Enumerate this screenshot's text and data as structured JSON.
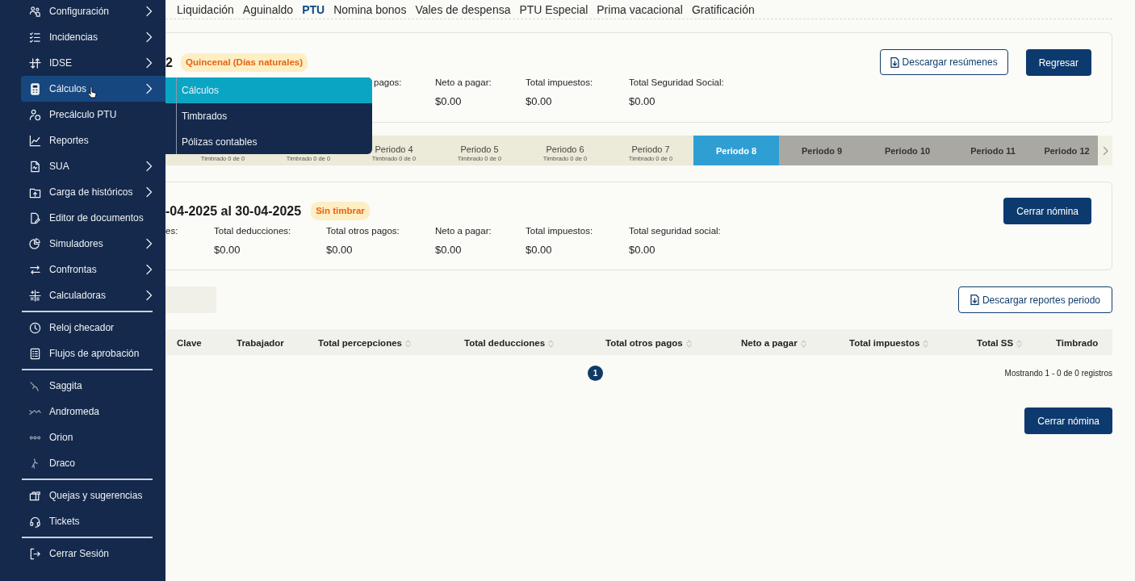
{
  "sidebar": {
    "groups": [
      {
        "items": [
          {
            "label": "Configuración",
            "submenu": true,
            "selected": false
          },
          {
            "label": "Incidencias",
            "submenu": true,
            "selected": false
          },
          {
            "label": "IDSE",
            "submenu": true,
            "selected": false
          },
          {
            "label": "Cálculos",
            "submenu": true,
            "selected": true
          },
          {
            "label": "Precálculo PTU",
            "submenu": false,
            "selected": false
          },
          {
            "label": "Reportes",
            "submenu": false,
            "selected": false
          },
          {
            "label": "SUA",
            "submenu": true,
            "selected": false
          },
          {
            "label": "Carga de históricos",
            "submenu": true,
            "selected": false
          },
          {
            "label": "Editor de documentos",
            "submenu": false,
            "selected": false
          },
          {
            "label": "Simuladores",
            "submenu": true,
            "selected": false
          },
          {
            "label": "Confrontas",
            "submenu": true,
            "selected": false
          },
          {
            "label": "Calculadoras",
            "submenu": true,
            "selected": false
          }
        ]
      },
      {
        "items": [
          {
            "label": "Reloj checador",
            "submenu": false,
            "selected": false
          },
          {
            "label": "Flujos de aprobación",
            "submenu": false,
            "selected": false
          }
        ]
      },
      {
        "items": [
          {
            "label": "Saggita",
            "submenu": false,
            "selected": false
          },
          {
            "label": "Andromeda",
            "submenu": false,
            "selected": false
          },
          {
            "label": "Orion",
            "submenu": false,
            "selected": false
          },
          {
            "label": "Draco",
            "submenu": false,
            "selected": false
          }
        ]
      },
      {
        "items": [
          {
            "label": "Quejas y sugerencias",
            "submenu": false,
            "selected": false
          },
          {
            "label": "Tickets",
            "submenu": false,
            "selected": false
          }
        ]
      },
      {
        "items": [
          {
            "label": "Cerrar Sesión",
            "submenu": false,
            "selected": false
          }
        ]
      }
    ]
  },
  "flyout": {
    "items": [
      {
        "label": "Cálculos",
        "selected": true
      },
      {
        "label": "Timbrados",
        "selected": false
      },
      {
        "label": "Pólizas contables",
        "selected": false
      }
    ]
  },
  "tabs": [
    {
      "label": "Liquidación",
      "selected": false
    },
    {
      "label": "Aguinaldo",
      "selected": false
    },
    {
      "label": "PTU",
      "selected": true
    },
    {
      "label": "Nomina bonos",
      "selected": false
    },
    {
      "label": "Vales de despensa",
      "selected": false
    },
    {
      "label": "PTU Especial",
      "selected": false
    },
    {
      "label": "Prima vacacional",
      "selected": false
    },
    {
      "label": "Gratificación",
      "selected": false
    }
  ],
  "summary": {
    "title": "2",
    "badge": "Quincenal (Días naturales)",
    "stats": [
      {
        "label": "pagos:"
      },
      {
        "label": "Neto a pagar:",
        "value": "$0.00"
      },
      {
        "label": "Total impuestos:",
        "value": "$0.00"
      },
      {
        "label": "Total Seguridad Social:",
        "value": "$0.00"
      }
    ],
    "buttons": [
      {
        "label": "Descargar resúmenes",
        "kind": "outline"
      },
      {
        "label": "Regresar",
        "kind": "solid"
      }
    ]
  },
  "periods": [
    {
      "subtitle": "Timbrado 0 de 0",
      "selected": false,
      "disabled": false
    },
    {
      "subtitle": "Timbrado 0 de 0",
      "selected": false,
      "disabled": false
    },
    {
      "label": "Periodo 4",
      "subtitle": "Timbrado 0 de 0",
      "selected": false,
      "disabled": false
    },
    {
      "label": "Periodo 5",
      "subtitle": "Timbrado 0 de 0",
      "selected": false,
      "disabled": false
    },
    {
      "label": "Periodo 6",
      "subtitle": "Timbrado 0 de 0",
      "selected": false,
      "disabled": false
    },
    {
      "label": "Periodo 7",
      "subtitle": "Timbrado 0 de 0",
      "selected": false,
      "disabled": false
    },
    {
      "label": "Periodo 8",
      "selected": true,
      "disabled": false
    },
    {
      "label": "Periodo 9",
      "selected": false,
      "disabled": true
    },
    {
      "label": "Periodo 10",
      "selected": false,
      "disabled": true
    },
    {
      "label": "Periodo 11",
      "selected": false,
      "disabled": true
    },
    {
      "label": "Periodo 12",
      "selected": false,
      "disabled": true
    }
  ],
  "period": {
    "title": "-04-2025 al 30-04-2025",
    "badge": "Sin timbrar",
    "stats": [
      {
        "label": "es:"
      },
      {
        "label": "Total deducciones:",
        "value": "$0.00"
      },
      {
        "label": "Total otros pagos:",
        "value": "$0.00"
      },
      {
        "label": "Neto a pagar:",
        "value": "$0.00"
      },
      {
        "label": "Total impuestos:",
        "value": "$0.00"
      },
      {
        "label": "Total seguridad social:",
        "value": "$0.00"
      }
    ],
    "button": "Cerrar nómina"
  },
  "report_button": "Descargar reportes periodo",
  "table": {
    "columns": [
      {
        "label": "Clave",
        "sortable": false
      },
      {
        "label": "Trabajador",
        "sortable": false
      },
      {
        "label": "Total percepciones",
        "sortable": true
      },
      {
        "label": "Total deducciones",
        "sortable": true
      },
      {
        "label": "Total otros pagos",
        "sortable": true
      },
      {
        "label": "Neto a pagar",
        "sortable": true
      },
      {
        "label": "Total impuestos",
        "sortable": true
      },
      {
        "label": "Total SS",
        "sortable": true
      },
      {
        "label": "Timbrado",
        "sortable": false
      }
    ]
  },
  "pagination": {
    "pages": [
      {
        "label": "1",
        "selected": true
      }
    ],
    "summary": "Mostrando 1 - 0 de 0 registros"
  },
  "footer_button": "Cerrar nómina"
}
